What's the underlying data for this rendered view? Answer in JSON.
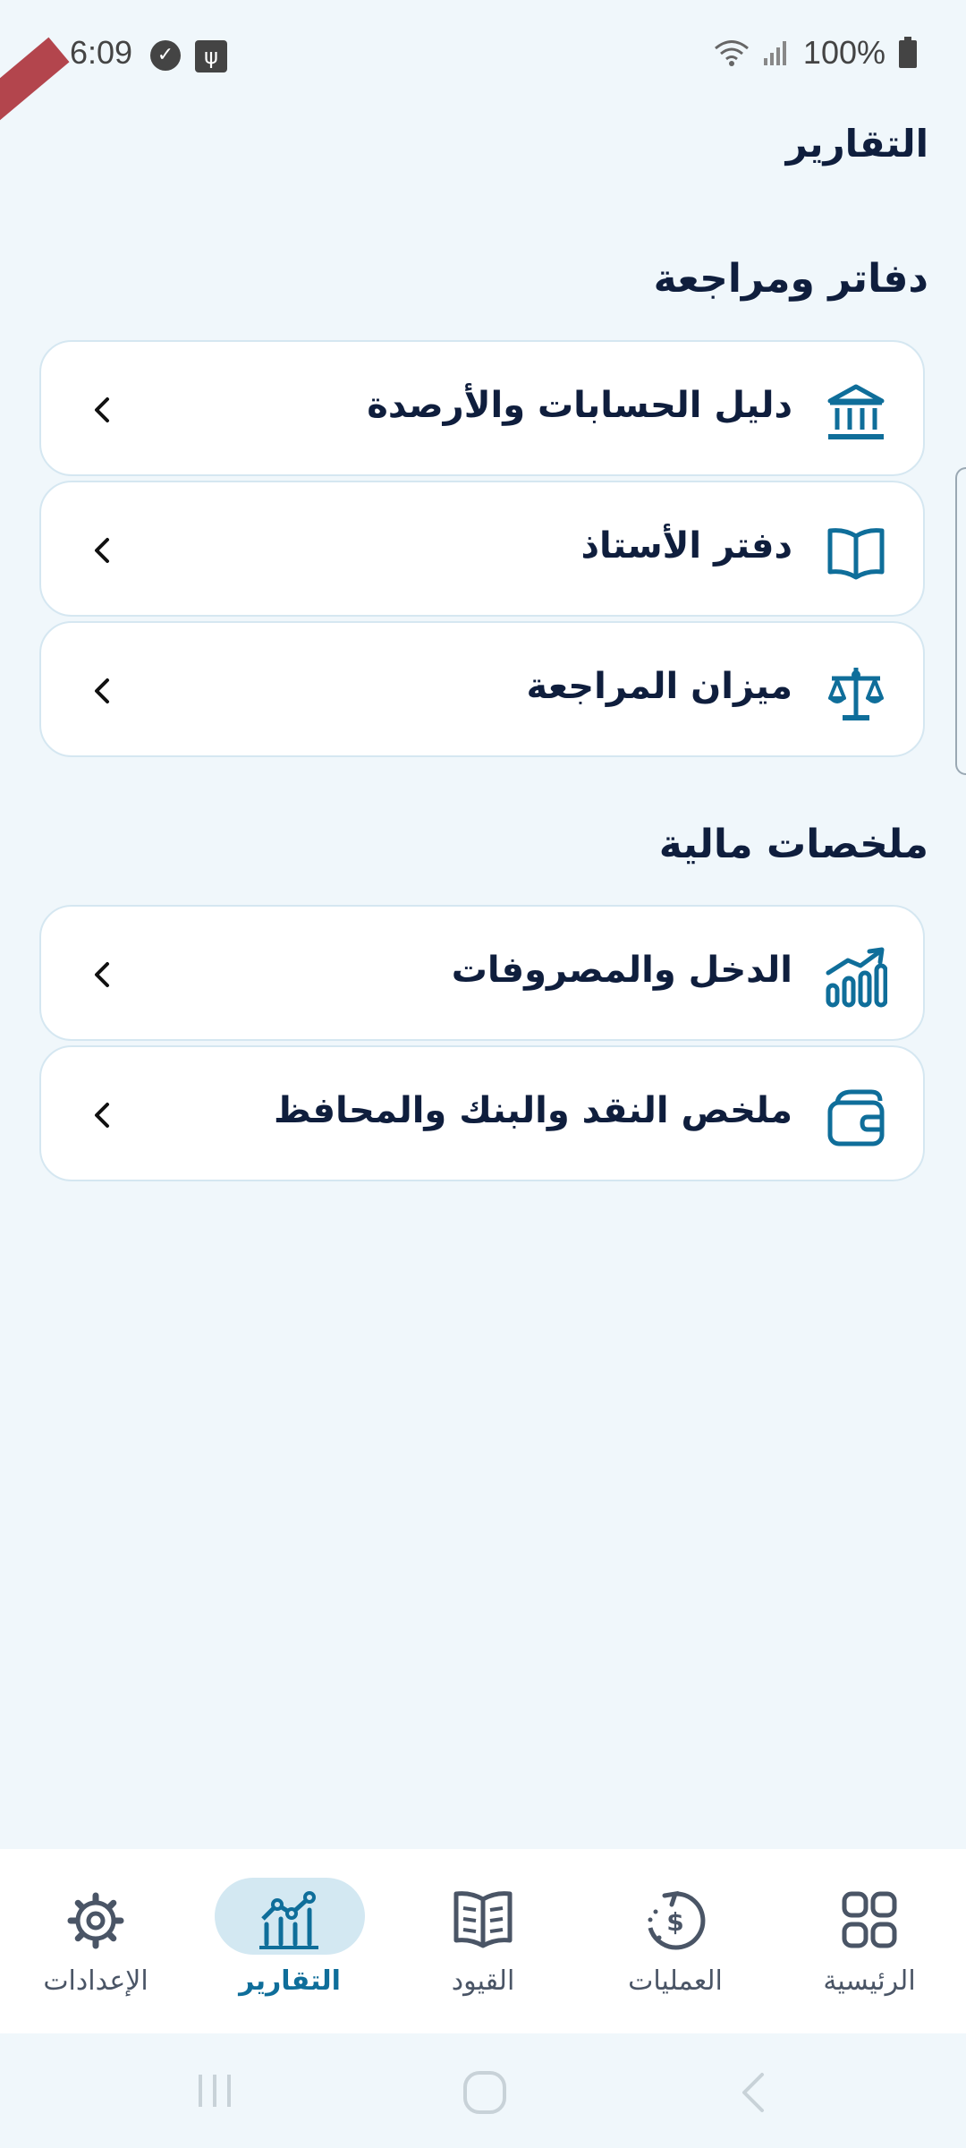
{
  "status": {
    "time": "6:09",
    "battery": "100%"
  },
  "page": {
    "title": "التقارير"
  },
  "sections": [
    {
      "title": "دفاتر ومراجعة",
      "items": [
        {
          "label": "دليل الحسابات والأرصدة",
          "icon": "bank-icon"
        },
        {
          "label": "دفتر الأستاذ",
          "icon": "book-icon"
        },
        {
          "label": "ميزان المراجعة",
          "icon": "scale-icon"
        }
      ]
    },
    {
      "title": "ملخصات مالية",
      "items": [
        {
          "label": "الدخل والمصروفات",
          "icon": "trend-chart-icon"
        },
        {
          "label": "ملخص النقد والبنك والمحافظ",
          "icon": "wallet-icon"
        }
      ]
    }
  ],
  "nav": {
    "items": [
      {
        "label": "الرئيسية",
        "icon": "grid-icon"
      },
      {
        "label": "العمليات",
        "icon": "dollar-cycle-icon"
      },
      {
        "label": "القيود",
        "icon": "journal-icon"
      },
      {
        "label": "التقارير",
        "icon": "reports-icon",
        "active": true
      },
      {
        "label": "الإعدادات",
        "icon": "gear-icon"
      }
    ]
  },
  "colors": {
    "accent": "#0f6e9a",
    "background": "#f0f7fb",
    "text": "#0f1e3d"
  }
}
